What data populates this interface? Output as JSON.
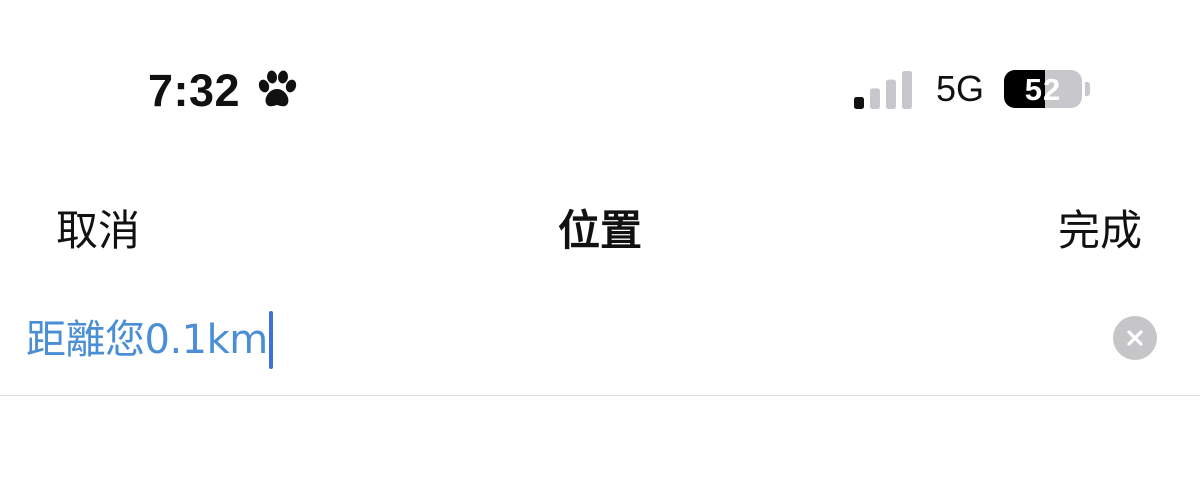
{
  "status_bar": {
    "time": "7:32",
    "focus_icon": "paw-icon",
    "signal_icon": "cellular-signal-icon",
    "signal_bars_active": 1,
    "signal_bars_total": 4,
    "network": "5G",
    "battery_level": "52",
    "battery_fraction": 0.52
  },
  "nav": {
    "cancel_label": "取消",
    "title": "位置",
    "done_label": "完成"
  },
  "location_input": {
    "value": "距離您0.1km",
    "clear_icon": "clear-x-icon"
  },
  "colors": {
    "input_text": "#4a8ed6",
    "caret": "#3c6fe0",
    "clear_button": "#c6c6c8",
    "battery_empty": "#c7c7cc"
  }
}
